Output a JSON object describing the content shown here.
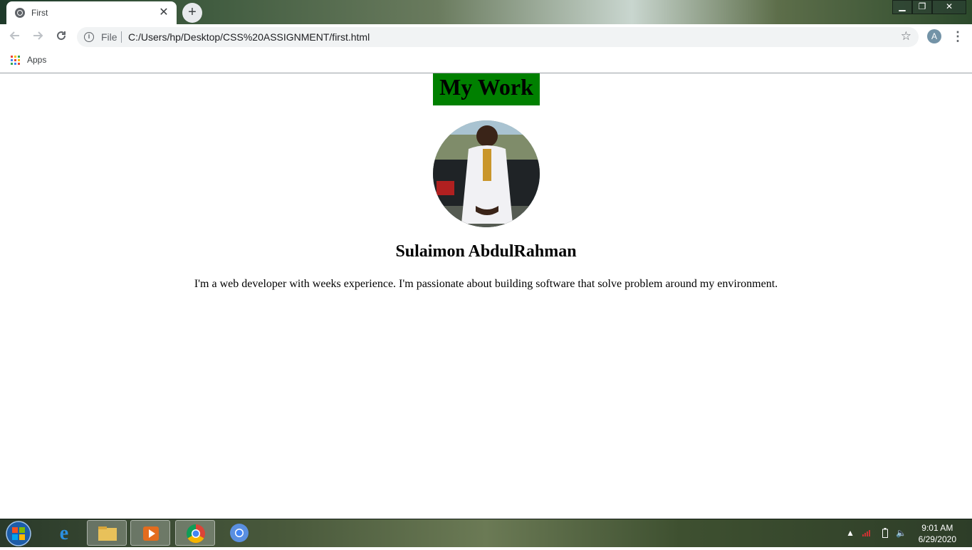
{
  "browser": {
    "tab_title": "First",
    "tab_close": "✕",
    "new_tab": "+",
    "scheme_label": "File",
    "url": "C:/Users/hp/Desktop/CSS%20ASSIGNMENT/first.html",
    "profile_initial": "A"
  },
  "window_controls": {
    "minimize": "▁",
    "restore": "❐",
    "close": "✕"
  },
  "bookmarks": {
    "apps_label": "Apps"
  },
  "page": {
    "heading": "My Work",
    "name": "Sulaimon AbdulRahman",
    "bio": "I'm a web developer with weeks experience. I'm passionate about building software that solve problem around my environment.",
    "heading_bg": "#008000"
  },
  "taskbar": {
    "time": "9:01 AM",
    "date": "6/29/2020",
    "items": [
      "start-icon",
      "internet-explorer-icon",
      "file-explorer-icon",
      "media-player-icon",
      "chrome-icon",
      "chrome-icon"
    ]
  }
}
